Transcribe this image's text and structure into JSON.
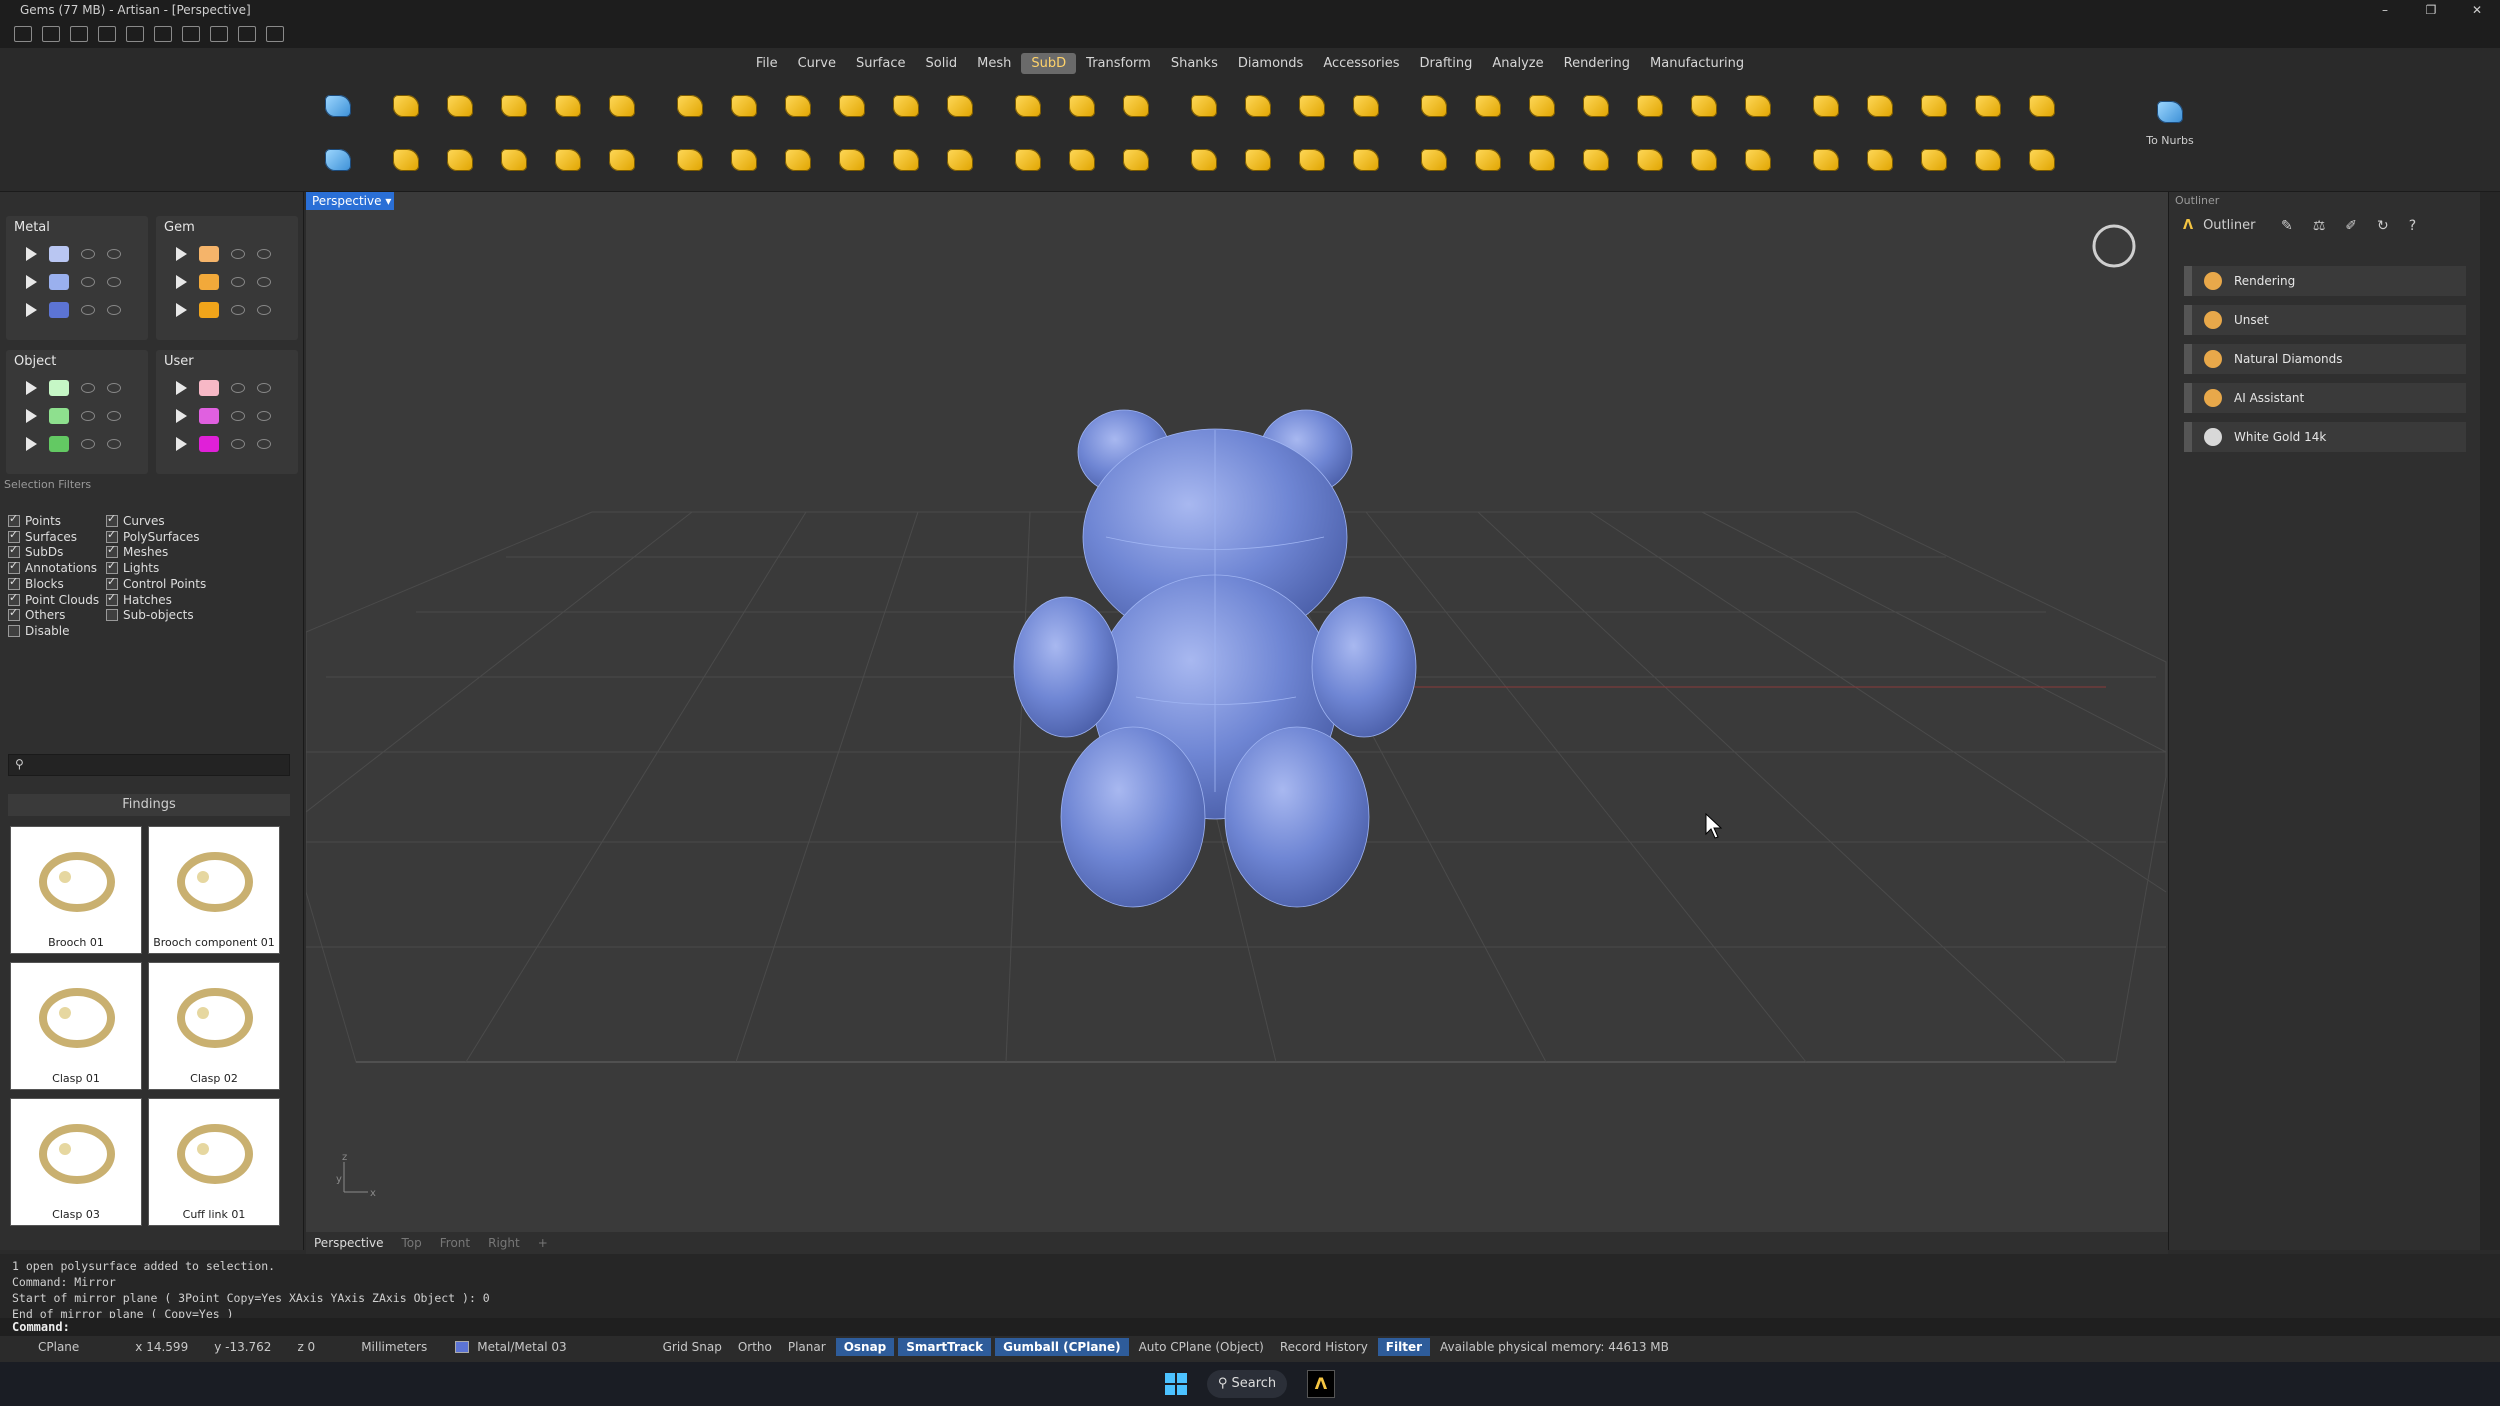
{
  "window": {
    "title": "Gems (77 MB) - Artisan - [Perspective]",
    "controls": [
      "–",
      "❐",
      "✕"
    ]
  },
  "menu": [
    "File",
    "Curve",
    "Surface",
    "Solid",
    "Mesh",
    "SubD",
    "Transform",
    "Shanks",
    "Diamonds",
    "Accessories",
    "Drafting",
    "Analyze",
    "Rendering",
    "Manufacturing"
  ],
  "menu_active": "SubD",
  "toolbar": {
    "to_nurbs_label": "To Nurbs"
  },
  "layers": {
    "metal": {
      "title": "Metal",
      "colors": [
        "#b9c6f2",
        "#9ab0ee",
        "#5c74d4"
      ]
    },
    "gem": {
      "title": "Gem",
      "colors": [
        "#f5b46a",
        "#f2a93a",
        "#f0a41a"
      ]
    },
    "object": {
      "title": "Object",
      "colors": [
        "#c6f7c6",
        "#8ee08e",
        "#63c963"
      ]
    },
    "user": {
      "title": "User",
      "colors": [
        "#f7b8c6",
        "#e060e0",
        "#e020d8"
      ]
    }
  },
  "selection_filters": {
    "title": "Selection Filters",
    "col1": [
      {
        "label": "Points",
        "checked": true
      },
      {
        "label": "Surfaces",
        "checked": true
      },
      {
        "label": "SubDs",
        "checked": true
      },
      {
        "label": "Annotations",
        "checked": true
      },
      {
        "label": "Blocks",
        "checked": true
      },
      {
        "label": "Point Clouds",
        "checked": true
      },
      {
        "label": "Others",
        "checked": true
      },
      {
        "label": "Disable",
        "checked": false
      }
    ],
    "col2": [
      {
        "label": "Curves",
        "checked": true
      },
      {
        "label": "PolySurfaces",
        "checked": true
      },
      {
        "label": "Meshes",
        "checked": true
      },
      {
        "label": "Lights",
        "checked": true
      },
      {
        "label": "Control Points",
        "checked": true
      },
      {
        "label": "Hatches",
        "checked": true
      },
      {
        "label": "Sub-objects",
        "checked": false
      }
    ]
  },
  "library": {
    "category": "Findings",
    "items": [
      {
        "label": "Brooch 01",
        "icon": "brooch-pin"
      },
      {
        "label": "Brooch component 01",
        "icon": "brooch-clasp"
      },
      {
        "label": "Clasp 01",
        "icon": "lobster-clasp"
      },
      {
        "label": "Clasp 02",
        "icon": "lobster-clasp"
      },
      {
        "label": "Clasp 03",
        "icon": "lobster-clasp"
      },
      {
        "label": "Cuff link 01",
        "icon": "cufflink"
      }
    ]
  },
  "viewport": {
    "name": "Perspective",
    "tabs": [
      "Perspective",
      "Top",
      "Front",
      "Right",
      "+"
    ],
    "active_tab": "Perspective",
    "axis": {
      "z": "z",
      "y": "y",
      "x": "x"
    }
  },
  "outliner": {
    "title": "Outliner",
    "panel_label": "Outliner",
    "items": [
      {
        "label": "Rendering",
        "color": "#e8a84a"
      },
      {
        "label": "Unset",
        "color": "#e8a84a"
      },
      {
        "label": "Natural Diamonds",
        "color": "#e8a84a"
      },
      {
        "label": "AI Assistant",
        "color": "#e8a84a"
      },
      {
        "label": "White Gold 14k",
        "color": "#d8d8d8"
      }
    ]
  },
  "command": {
    "history": [
      "1 open polysurface added to selection.",
      "Command: Mirror",
      "Start of mirror plane ( 3Point  Copy=Yes  XAxis  YAxis  ZAxis  Object ): 0",
      "End of mirror plane ( Copy=Yes )"
    ],
    "prompt": "Command:"
  },
  "status": {
    "cplane": "CPlane",
    "x": "x 14.599",
    "y": "y -13.762",
    "z": "z 0",
    "units": "Millimeters",
    "layer": "Metal/Metal 03",
    "toggles": [
      {
        "label": "Grid Snap",
        "on": false
      },
      {
        "label": "Ortho",
        "on": false
      },
      {
        "label": "Planar",
        "on": false
      },
      {
        "label": "Osnap",
        "on": true
      },
      {
        "label": "SmartTrack",
        "on": true
      },
      {
        "label": "Gumball (CPlane)",
        "on": true
      },
      {
        "label": "Auto CPlane (Object)",
        "on": false
      },
      {
        "label": "Record History",
        "on": false
      },
      {
        "label": "Filter",
        "on": true
      }
    ],
    "memory": "Available physical memory: 44613 MB"
  },
  "taskbar": {
    "search": "Search"
  }
}
